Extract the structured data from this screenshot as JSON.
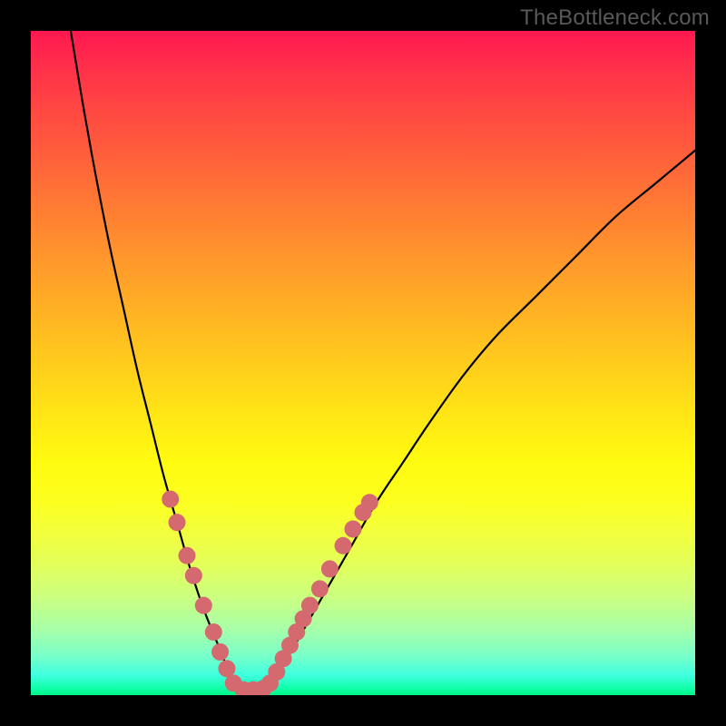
{
  "watermark": "TheBottleneck.com",
  "colors": {
    "black": "#000000",
    "curve": "#000000",
    "dot": "#d46a6f",
    "dot_stroke": "#c65b61"
  },
  "chart_data": {
    "type": "line",
    "title": "",
    "xlabel": "",
    "ylabel": "",
    "xlim": [
      0,
      100
    ],
    "ylim": [
      0,
      100
    ],
    "series": [
      {
        "name": "left-branch",
        "x": [
          6,
          8,
          10,
          12,
          14,
          16,
          18,
          20,
          22,
          24,
          26,
          28,
          30,
          31
        ],
        "y": [
          100,
          88,
          77,
          67,
          58,
          49,
          41,
          33,
          26,
          19,
          13,
          8,
          3,
          0.5
        ]
      },
      {
        "name": "right-branch",
        "x": [
          35,
          37,
          40,
          44,
          48,
          52,
          56,
          60,
          65,
          70,
          76,
          82,
          88,
          94,
          100
        ],
        "y": [
          0.5,
          3,
          8,
          15,
          22,
          29,
          35,
          41,
          48,
          54,
          60,
          66,
          72,
          77,
          82
        ]
      }
    ],
    "scatter_clusters": [
      {
        "name": "left-cluster",
        "points": [
          {
            "x": 21.0,
            "y": 29.5
          },
          {
            "x": 22.0,
            "y": 26.0
          },
          {
            "x": 23.5,
            "y": 21.0
          },
          {
            "x": 24.5,
            "y": 18.0
          },
          {
            "x": 26.0,
            "y": 13.5
          },
          {
            "x": 27.5,
            "y": 9.5
          },
          {
            "x": 28.5,
            "y": 6.5
          },
          {
            "x": 29.5,
            "y": 4.0
          }
        ]
      },
      {
        "name": "bottom-cluster",
        "points": [
          {
            "x": 30.5,
            "y": 1.8
          },
          {
            "x": 32.0,
            "y": 0.8
          },
          {
            "x": 33.5,
            "y": 0.8
          },
          {
            "x": 35.0,
            "y": 1.0
          },
          {
            "x": 36.0,
            "y": 1.8
          }
        ]
      },
      {
        "name": "right-cluster",
        "points": [
          {
            "x": 37.0,
            "y": 3.5
          },
          {
            "x": 38.0,
            "y": 5.5
          },
          {
            "x": 39.0,
            "y": 7.5
          },
          {
            "x": 40.0,
            "y": 9.5
          },
          {
            "x": 41.0,
            "y": 11.5
          },
          {
            "x": 42.0,
            "y": 13.5
          },
          {
            "x": 43.5,
            "y": 16.0
          },
          {
            "x": 45.0,
            "y": 19.0
          },
          {
            "x": 47.0,
            "y": 22.5
          },
          {
            "x": 48.5,
            "y": 25.0
          },
          {
            "x": 50.0,
            "y": 27.5
          },
          {
            "x": 51.0,
            "y": 29.0
          }
        ]
      }
    ]
  }
}
